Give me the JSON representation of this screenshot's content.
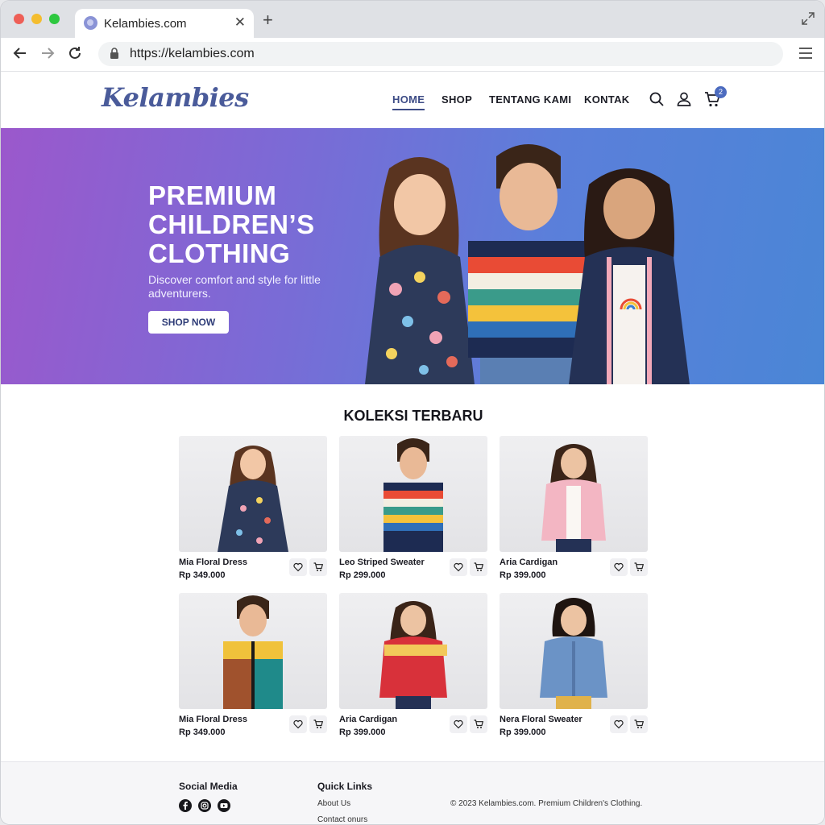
{
  "browser": {
    "tab_title": "Kelambies.com",
    "url": "https://kelambies.com"
  },
  "header": {
    "logo": "Kelambies",
    "nav": [
      "HOME",
      "SHOP",
      "TENTANG KAMI",
      "KONTAK"
    ],
    "active_nav": "HOME",
    "cart_count": "2"
  },
  "hero": {
    "title_lines": [
      "PREMIUM",
      "CHILDREN’S",
      "CLOTHING"
    ],
    "subtitle": "Discover comfort and style for little adventurers.",
    "button": "SHOP NOW"
  },
  "collection": {
    "title": "KOLEKSI TERBARU",
    "products": [
      {
        "name": "Mia Floral Dress",
        "price": "Rp 349.000"
      },
      {
        "name": "Leo Striped Sweater",
        "price": "Rp 299.000"
      },
      {
        "name": "Aria Cardigan",
        "price": "Rp 399.000"
      },
      {
        "name": "Mia Floral Dress",
        "price": "Rp 349.000"
      },
      {
        "name": "Aria Cardigan",
        "price": "Rp 399.000"
      },
      {
        "name": "Nera Floral Sweater",
        "price": "Rp 399.000"
      }
    ]
  },
  "footer": {
    "social_title": "Social Media",
    "social_icons": [
      "facebook-icon",
      "instagram-icon",
      "youtube-icon"
    ],
    "links_title": "Quick Links",
    "links": [
      "About Us",
      "Contact onurs"
    ],
    "copyright": "© 2023 Kelambies.com. Premium Children's Clothing."
  },
  "colors": {
    "brand": "#4a5b9a",
    "accent": "#4c6bbf",
    "hero_start": "#9b58cc",
    "hero_end": "#4a86d6"
  }
}
